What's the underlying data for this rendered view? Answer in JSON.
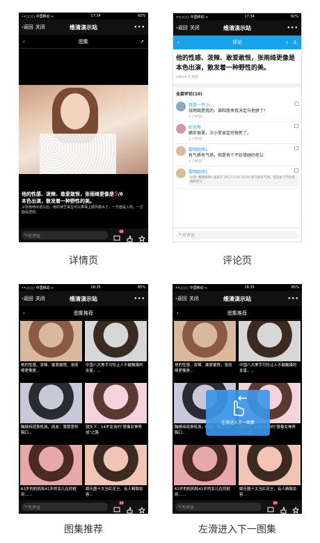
{
  "status": {
    "carrier": "••○○○ 中国移动 ≈",
    "time1": "17:34",
    "time2": "18:35",
    "battery1": "92%",
    "battery2": "85%"
  },
  "nav": {
    "back": "返回",
    "close": "关闭",
    "title": "维清演示站",
    "more": "•••"
  },
  "detail": {
    "subtitle": "图集",
    "headline": "他的性感、泼辣、敢爱敢恨，张雨绮更像是",
    "headline2": "本色出演，散发着一种野性的美。",
    "page_current": "5",
    "page_total": "/6",
    "desc": "从张雨绮出道以后，她的演艺事业可以算得上顺风顺水了，一方面是入戏，一方面是选戏。",
    "write": "写评论",
    "badge": "10"
  },
  "comments": {
    "subtitle": "评论",
    "article_title": "他的性感、泼辣、敢爱敢恨，张雨绮更像是本色出演，散发着一种野性的美。",
    "meta": "admin  3 天前",
    "header": "全部评论(10)",
    "items": [
      {
        "name": "我是一只小...",
        "text": "张雨绮是我的，谁和我争我决定与他拼了！",
        "time": "1 小时前",
        "avatar": "#8ab"
      },
      {
        "name": "妙克帝",
        "text": "确实很美，汪小菲肯定后悔死了。",
        "time": "1 小时前",
        "avatar": "#c9a"
      },
      {
        "name": "黎明砸砖s",
        "text": "有气质有气场，但是有个不珍惜她的老公",
        "time": "1 小时前",
        "avatar": "#db9"
      },
      {
        "name": "黎明砸砖s",
        "quote": "引用: 黎明砸砖s 发表于 2017-7-24 15:59 有气质有气场，但是有个不珍惜她的老公",
        "avatar": "#db9"
      }
    ],
    "write": "写评论"
  },
  "recommend": {
    "subtitle": "图集推荐",
    "items": [
      {
        "text": "他的性感、泼辣、敢爱敢恨，张雨绮更像是...",
        "colors": [
          "#d9b8a0",
          "#8a5a44"
        ]
      },
      {
        "text": "中国八大美手可怜让人不敢触摸的女星，...",
        "colors": [
          "#d7d7d7",
          "#3a2a22"
        ]
      },
      {
        "text": "鞠婧祎现身机场，网友：我愿意你胸口...",
        "colors": [
          "#c8c8d8",
          "#2a2a33"
        ]
      },
      {
        "text": "镜头下：14岁女孩约\"景像女神养成\"之路",
        "colors": [
          "#f4d4dc",
          "#5a3a30"
        ]
      },
      {
        "text": "63岁的妈妈和41岁的女儿在同框到……",
        "colors": [
          "#e6a8a8",
          "#4a2a22"
        ]
      },
      {
        "text": "娱乐圈十大当红花旦，有人精致妆容...",
        "colors": [
          "#f1c4b4",
          "#3a2a22"
        ]
      }
    ],
    "write": "写评论",
    "badge": "10"
  },
  "swipe_hint": "左滑进入下一图集",
  "captions": {
    "c1": "详情页",
    "c2": "评论页",
    "c3": "图集推荐",
    "c4": "左滑进入下一图集"
  }
}
